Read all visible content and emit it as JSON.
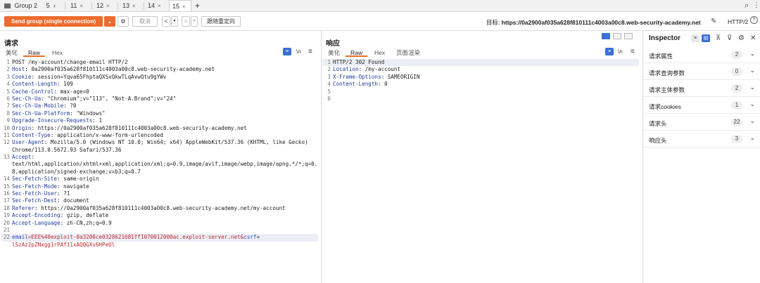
{
  "tabs": {
    "group": {
      "label": "Group 2",
      "count": "5"
    },
    "items": [
      {
        "label": "11"
      },
      {
        "label": "12"
      },
      {
        "label": "13"
      },
      {
        "label": "14"
      },
      {
        "label": "15"
      }
    ],
    "add": "+",
    "close": "×",
    "nav_left": "‹"
  },
  "toolbar": {
    "send_label": "Send group (single connection)",
    "send_dropdown": "⌄",
    "cancel_label": "取消",
    "prev": "<",
    "next": ">",
    "follow_redirect_label": "跟随重定向",
    "target_prefix": "目标:",
    "target_url": "https://0a2900af035a628f810111c4003a00c8.web-security-academy.net",
    "http_version": "HTTP/2",
    "help": "?"
  },
  "request": {
    "title": "请求",
    "tabs": [
      "美化",
      "Raw",
      "Hex"
    ],
    "active_tab": "Raw",
    "lines": [
      {
        "n": "1",
        "name": "",
        "value": "POST /my-account/change-email HTTP/2"
      },
      {
        "n": "2",
        "name": "Host",
        "value": ": 0a2900af035a628f810111c4003a00c8.web-security-academy.net"
      },
      {
        "n": "3",
        "name": "Cookie",
        "value": ": session=Yqva65FhptaQXSxQkwTLqAvwQtu9gYWv"
      },
      {
        "n": "4",
        "name": "Content-Length",
        "value": ": 109"
      },
      {
        "n": "5",
        "name": "Cache-Control",
        "value": ": max-age=0"
      },
      {
        "n": "6",
        "name": "Sec-Ch-Ua",
        "value": ": \"Chromium\";v=\"113\", \"Not-A.Brand\";v=\"24\""
      },
      {
        "n": "7",
        "name": "Sec-Ch-Ua-Mobile",
        "value": ": ?0"
      },
      {
        "n": "8",
        "name": "Sec-Ch-Ua-Platform",
        "value": ": \"Windows\""
      },
      {
        "n": "9",
        "name": "Upgrade-Insecure-Requests",
        "value": ": 1"
      },
      {
        "n": "10",
        "name": "Origin",
        "value": ": https://0a2900af035a628f810111c4003a00c8.web-security-academy.net"
      },
      {
        "n": "11",
        "name": "Content-Type",
        "value": ": application/x-www-form-urlencoded"
      },
      {
        "n": "12",
        "name": "User-Agent",
        "value": ": Mozilla/5.0 (Windows NT 10.0; Win64; x64) AppleWebKit/537.36 (KHTML, like Gecko)"
      },
      {
        "n": "",
        "name": "",
        "value": "Chrome/113.0.5672.93 Safari/537.36"
      },
      {
        "n": "13",
        "name": "Accept",
        "value": ":"
      },
      {
        "n": "",
        "name": "",
        "value": "text/html,application/xhtml+xml,application/xml;q=0.9,image/avif,image/webp,image/apng,*/*;q=0."
      },
      {
        "n": "",
        "name": "",
        "value": "8,application/signed-exchange;v=b3;q=0.7"
      },
      {
        "n": "14",
        "name": "Sec-Fetch-Site",
        "value": ": same-origin"
      },
      {
        "n": "15",
        "name": "Sec-Fetch-Mode",
        "value": ": navigate"
      },
      {
        "n": "16",
        "name": "Sec-Fetch-User",
        "value": ": ?1"
      },
      {
        "n": "17",
        "name": "Sec-Fetch-Dest",
        "value": ": document"
      },
      {
        "n": "18",
        "name": "Referer",
        "value": ": https://0a2900af035a628f810111c4003a00c8.web-security-academy.net/my-account"
      },
      {
        "n": "19",
        "name": "Accept-Encoding",
        "value": ": gzip, deflate"
      },
      {
        "n": "20",
        "name": "Accept-Language",
        "value": ": zh-CN,zh;q=0.9"
      },
      {
        "n": "21",
        "name": "",
        "value": ""
      },
      {
        "n": "22",
        "name": "",
        "value": ""
      }
    ],
    "body_line1_a": "email",
    "body_line1_b": "=EEE%40exploit-0a3200ce0328621681ff1070012000ac.exploit-server.net&",
    "body_line1_c": "csrf",
    "body_line1_d": "=",
    "body_line2": "lSzAz2pZNxgg1rPAf11xAQQGXv6HPeUl",
    "icons": [
      "≡",
      "\\n",
      "≡"
    ]
  },
  "response": {
    "title": "响应",
    "tabs": [
      "美化",
      "Raw",
      "Hex",
      "页面渲染"
    ],
    "active_tab": "Raw",
    "lines": [
      {
        "n": "1",
        "name": "",
        "value": "HTTP/2 302 Found"
      },
      {
        "n": "2",
        "name": "Location",
        "value": ": /my-account"
      },
      {
        "n": "3",
        "name": "X-Frame-Options",
        "value": ": SAMEORIGIN"
      },
      {
        "n": "4",
        "name": "Content-Length",
        "value": ": 0"
      },
      {
        "n": "5",
        "name": "",
        "value": ""
      },
      {
        "n": "6",
        "name": "",
        "value": ""
      }
    ],
    "icons": [
      "≡",
      "\\n",
      "≡"
    ]
  },
  "inspector": {
    "title": "Inspector",
    "rows": [
      {
        "label": "请求属性",
        "count": "2"
      },
      {
        "label": "请求查询参数",
        "count": "0"
      },
      {
        "label": "请求主体参数",
        "count": "2"
      },
      {
        "label": "请求cookies",
        "count": "1"
      },
      {
        "label": "请求头",
        "count": "22"
      },
      {
        "label": "响应头",
        "count": "3"
      }
    ],
    "chevron": "⌄",
    "icons": [
      "≡",
      "▤",
      "⊼",
      "⊽",
      "⚙",
      "✕"
    ]
  },
  "colors": {
    "accent": "#ec6b2d",
    "header_name": "#1f3d9e",
    "body_red": "#c0282e",
    "select_blue": "#3a6fd6"
  }
}
